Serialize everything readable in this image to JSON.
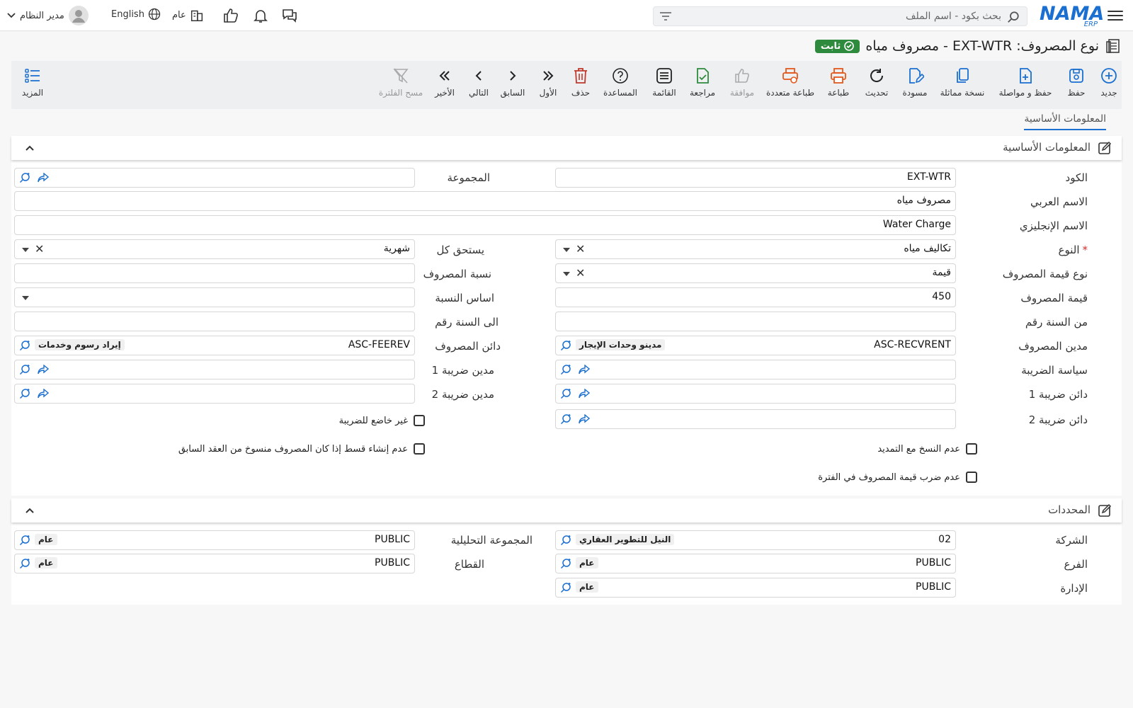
{
  "topbar": {
    "search_placeholder": "بحث بكود - اسم الملف",
    "user_name": "مدير النظام",
    "language": "English",
    "branch": "عام",
    "logo_text": "NAMA",
    "logo_sub": "ERP"
  },
  "header": {
    "title": "نوع المصروف: EXT-WTR - مصروف مياه",
    "status_badge": "ثابت"
  },
  "toolbar": {
    "new": "جديد",
    "save": "حفظ",
    "save_continue": "حفظ و مواصلة",
    "duplicate": "نسخة مماثلة",
    "draft": "مسودة",
    "refresh": "تحديث",
    "print": "طباعة",
    "multi_print": "طباعة متعددة",
    "approve": "موافقة",
    "review": "مراجعة",
    "list": "القائمة",
    "help": "المساعدة",
    "delete": "حذف",
    "first": "الأول",
    "previous": "السابق",
    "next": "التالي",
    "last": "الأخير",
    "clear_filter": "مسح الفلترة",
    "more": "المزيد"
  },
  "tabs": {
    "basic": "المعلومات الأساسية"
  },
  "basic_section": {
    "title": "المعلومات الأساسية",
    "labels": {
      "code": "الكود",
      "group": "المجموعة",
      "arabic_name": "الاسم العربي",
      "english_name": "الاسم الإنجليزي",
      "type": "النوع",
      "due_every": "يستحق كل",
      "value_type": "نوع قيمة المصروف",
      "expense_ratio": "نسبة المصروف",
      "expense_value": "قيمة المصروف",
      "ratio_basis": "اساس النسبة",
      "from_year": "من السنة رقم",
      "to_year": "الى السنة رقم",
      "debit_account": "مدين المصروف",
      "credit_account": "دائن المصروف",
      "tax_policy": "سياسة الضريبة",
      "tax_debit1": "مدين ضريبة 1",
      "tax_credit1": "دائن ضريبة 1",
      "tax_debit2": "مدين ضريبة 2",
      "tax_credit2": "دائن ضريبة 2"
    },
    "values": {
      "code": "EXT-WTR",
      "arabic_name": "مصروف مياه",
      "english_name": "Water Charge",
      "type": "تكاليف مياه",
      "due_every": "شهرية",
      "value_type": "قيمة",
      "expense_value": "450",
      "debit_account_code": "ASC-RECVRENT",
      "debit_account_name": "مدينو وحدات الإيجار",
      "credit_account_code": "ASC-FEEREV",
      "credit_account_name": "إيراد رسوم وخدمات"
    },
    "checkboxes": {
      "not_taxable": "غير خاضع للضريبة",
      "no_installment": "عدم إنشاء قسط إذا كان المصروف منسوخ من العقد السابق",
      "no_copy_renewal": "عدم النسخ مع التمديد",
      "no_multiply_period": "عدم ضرب قيمة المصروف في الفترة"
    }
  },
  "dimensions_section": {
    "title": "المحددات",
    "labels": {
      "company": "الشركة",
      "analysis_group": "المجموعة التحليلية",
      "branch": "الفرع",
      "sector": "القطاع",
      "department": "الإدارة"
    },
    "values": {
      "company_code": "02",
      "company_name": "النيل للتطوير العقاري",
      "analysis_code": "PUBLIC",
      "analysis_name": "عام",
      "branch_code": "PUBLIC",
      "branch_name": "عام",
      "sector_code": "PUBLIC",
      "sector_name": "عام",
      "department_code": "PUBLIC",
      "department_name": "عام"
    }
  },
  "colors": {
    "brand": "#1a6fd1",
    "badge": "#2e8b3d",
    "print": "#e4581c",
    "review": "#2e8b3d",
    "delete": "#c0392b"
  }
}
